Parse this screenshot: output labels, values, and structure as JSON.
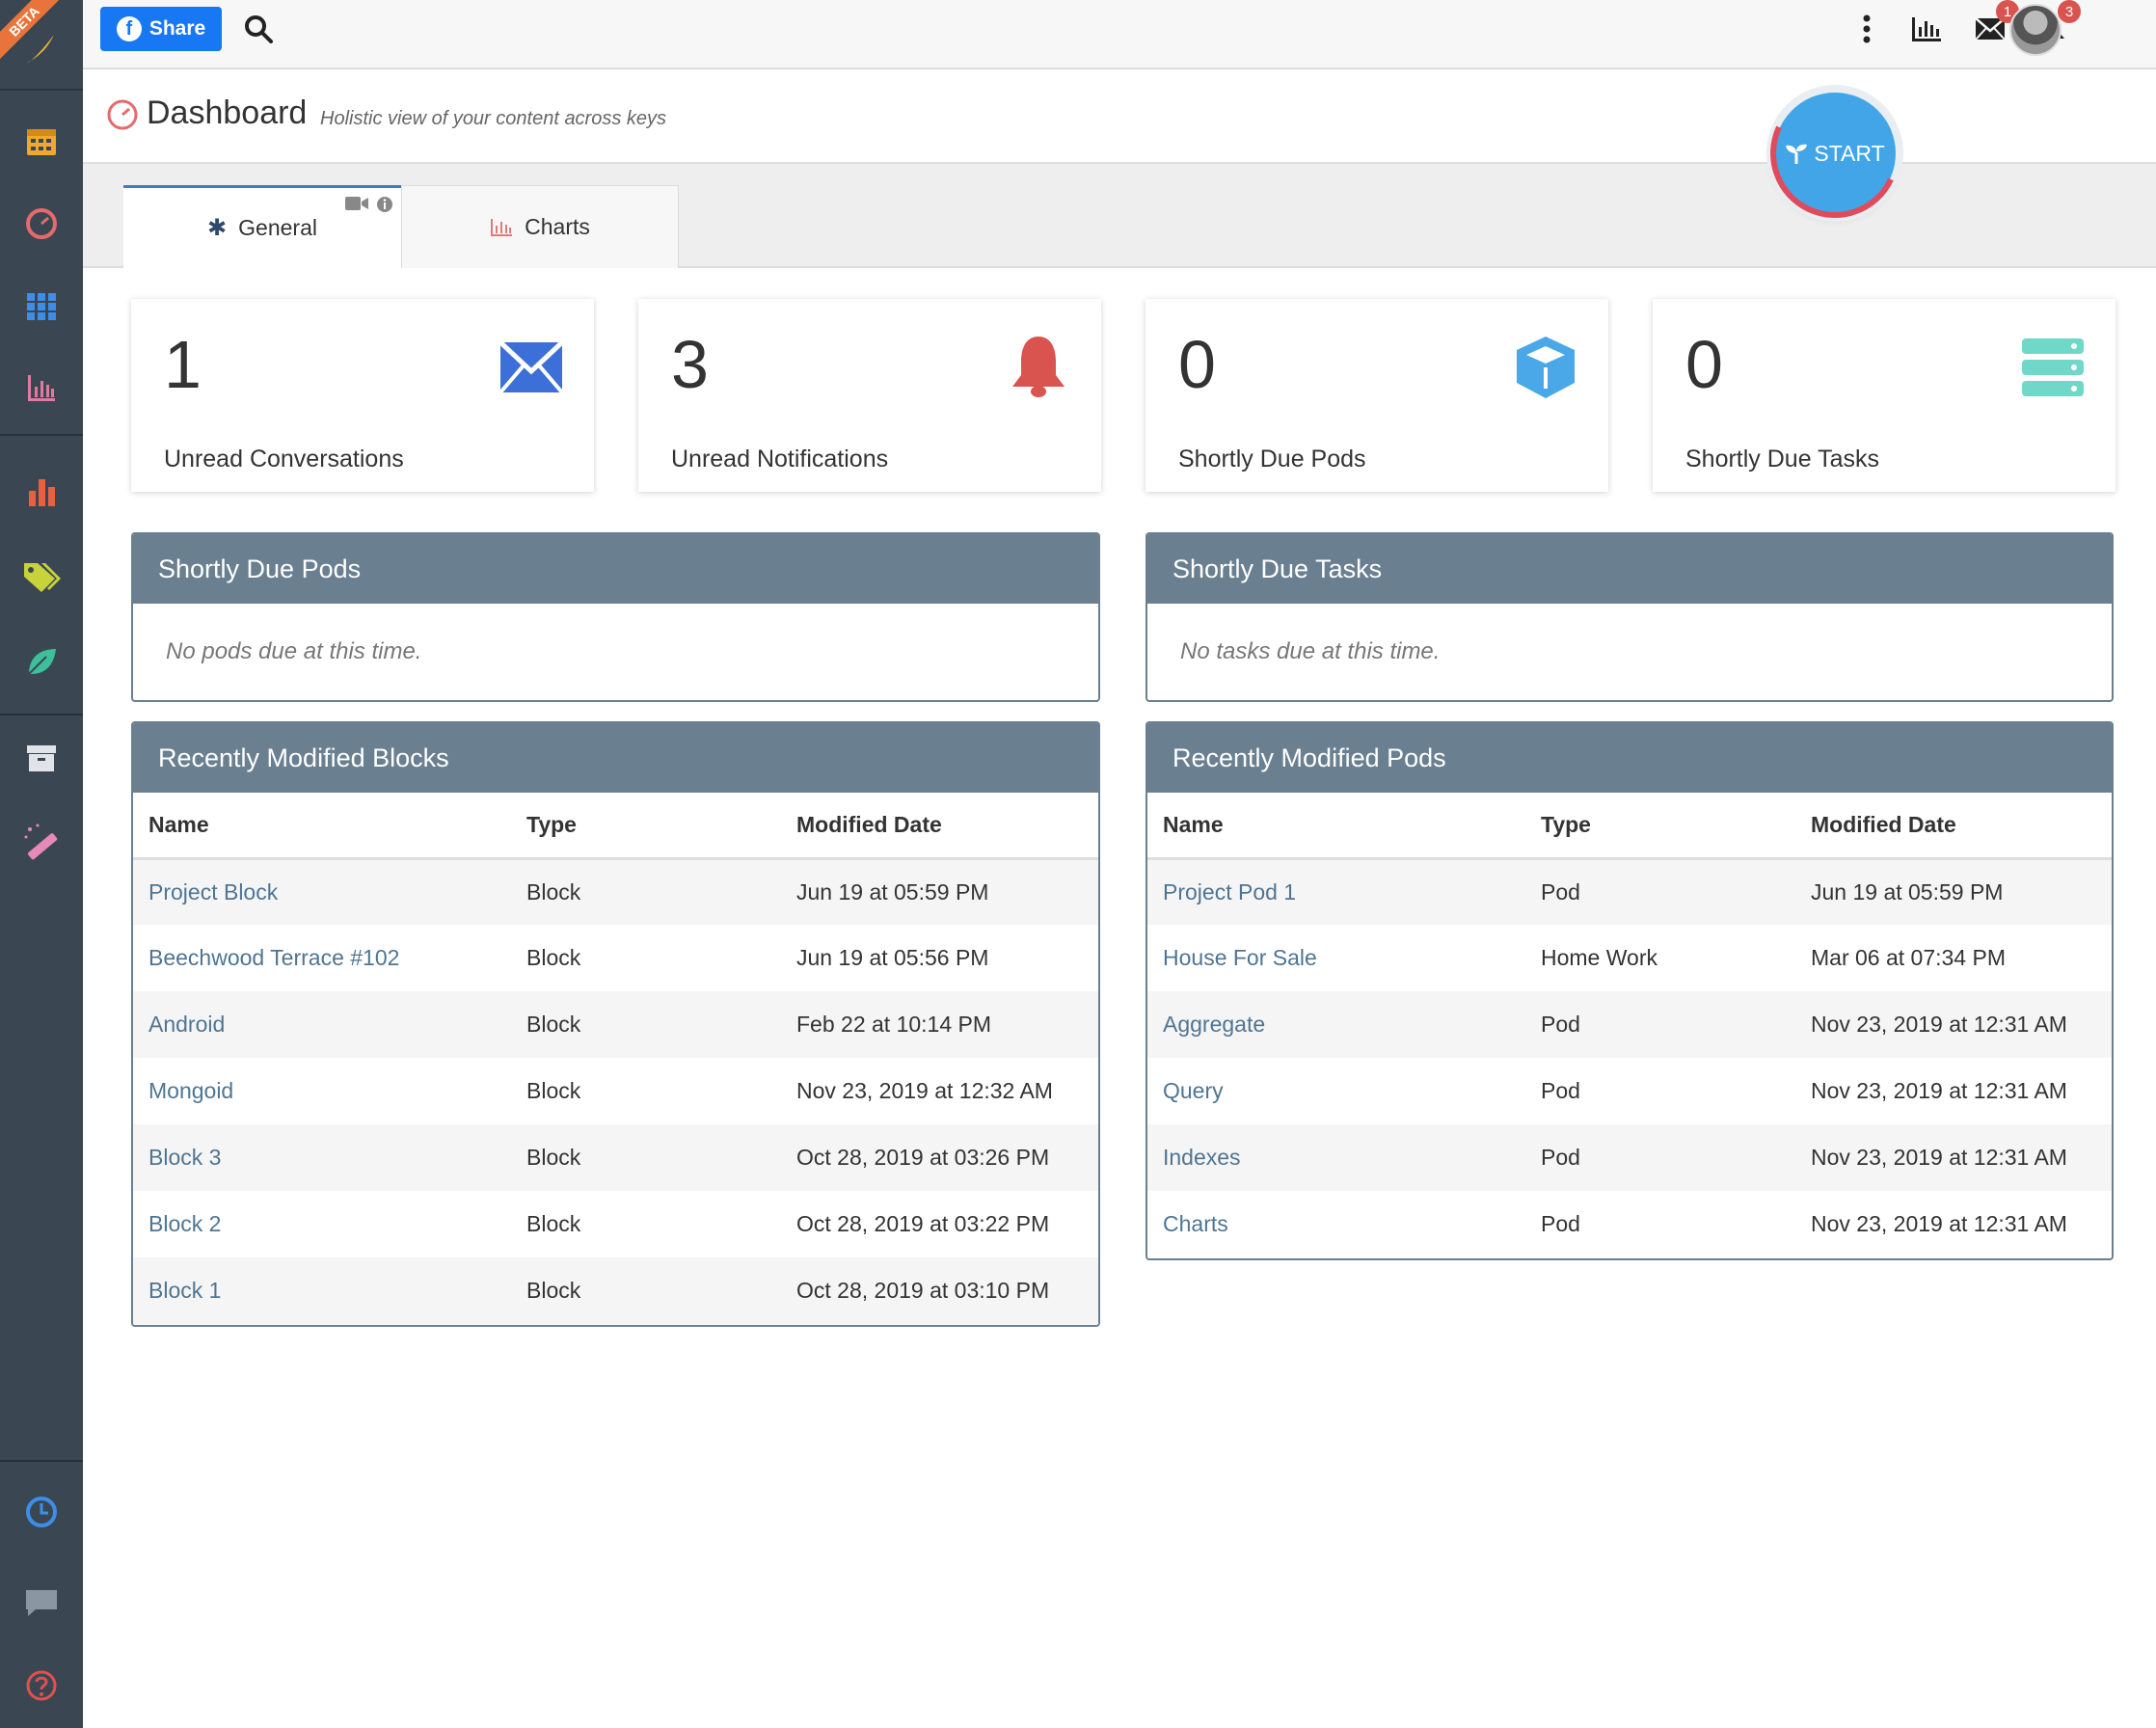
{
  "sidebar": {
    "beta": "BETA",
    "icons": [
      "brand-feather-icon",
      "calendar-icon",
      "dashboard-gauge-icon",
      "grid-icon",
      "bar-chart-outline-icon",
      "bar-chart-icon",
      "tags-icon",
      "leaf-icon",
      "archive-icon",
      "magic-wand-icon",
      "clock-icon",
      "chat-icon",
      "help-icon"
    ]
  },
  "topbar": {
    "share_label": "Share",
    "messages_badge": "1",
    "notifications_badge": "3"
  },
  "header": {
    "title": "Dashboard",
    "subtitle": "Holistic view of your content across keys",
    "start_label": "START"
  },
  "tabs": [
    {
      "label": "General",
      "active": true
    },
    {
      "label": "Charts",
      "active": false
    }
  ],
  "stats": [
    {
      "value": "1",
      "label": "Unread Conversations",
      "icon": "envelope-icon",
      "color": "#3d6fd8"
    },
    {
      "value": "3",
      "label": "Unread Notifications",
      "icon": "bell-icon",
      "color": "#d9534f"
    },
    {
      "value": "0",
      "label": "Shortly Due Pods",
      "icon": "cube-icon",
      "color": "#4aa8e8"
    },
    {
      "value": "0",
      "label": "Shortly Due Tasks",
      "icon": "server-icon",
      "color": "#6fd8c8"
    }
  ],
  "due_pods": {
    "title": "Shortly Due Pods",
    "empty": "No pods due at this time."
  },
  "due_tasks": {
    "title": "Shortly Due Tasks",
    "empty": "No tasks due at this time."
  },
  "blocks": {
    "title": "Recently Modified Blocks",
    "columns": [
      "Name",
      "Type",
      "Modified Date"
    ],
    "rows": [
      [
        "Project Block",
        "Block",
        "Jun 19 at 05:59 PM"
      ],
      [
        "Beechwood Terrace #102",
        "Block",
        "Jun 19 at 05:56 PM"
      ],
      [
        "Android",
        "Block",
        "Feb 22 at 10:14 PM"
      ],
      [
        "Mongoid",
        "Block",
        "Nov 23, 2019 at 12:32 AM"
      ],
      [
        "Block 3",
        "Block",
        "Oct 28, 2019 at 03:26 PM"
      ],
      [
        "Block 2",
        "Block",
        "Oct 28, 2019 at 03:22 PM"
      ],
      [
        "Block 1",
        "Block",
        "Oct 28, 2019 at 03:10 PM"
      ]
    ]
  },
  "pods": {
    "title": "Recently Modified Pods",
    "columns": [
      "Name",
      "Type",
      "Modified Date"
    ],
    "rows": [
      [
        "Project Pod 1",
        "Pod",
        "Jun 19 at 05:59 PM"
      ],
      [
        "House For Sale",
        "Home Work",
        "Mar 06 at 07:34 PM"
      ],
      [
        "Aggregate",
        "Pod",
        "Nov 23, 2019 at 12:31 AM"
      ],
      [
        "Query",
        "Pod",
        "Nov 23, 2019 at 12:31 AM"
      ],
      [
        "Indexes",
        "Pod",
        "Nov 23, 2019 at 12:31 AM"
      ],
      [
        "Charts",
        "Pod",
        "Nov 23, 2019 at 12:31 AM"
      ]
    ]
  }
}
